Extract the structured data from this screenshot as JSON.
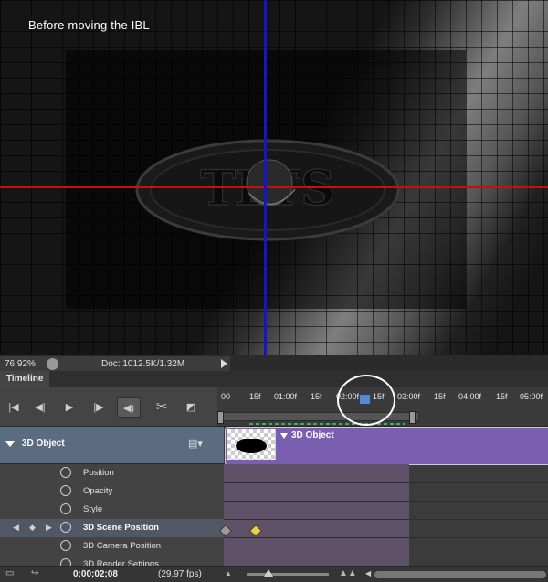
{
  "viewport": {
    "caption": "Before moving the IBL",
    "logo_text": "TLTS"
  },
  "status": {
    "zoom": "76.92%",
    "doc": "Doc: 1012.5K/1.32M"
  },
  "panel": {
    "tab": "Timeline"
  },
  "ruler": {
    "ticks": [
      "00",
      "15f",
      "01:00f",
      "15f",
      "02:00f",
      "15f",
      "03:00f",
      "15f",
      "04:00f",
      "15f",
      "05:00f"
    ]
  },
  "layer": {
    "name": "3D Object",
    "clip_title": "3D Object",
    "properties": [
      {
        "label": "Position"
      },
      {
        "label": "Opacity"
      },
      {
        "label": "Style"
      },
      {
        "label": "3D Scene Position"
      },
      {
        "label": "3D Camera Position"
      },
      {
        "label": "3D Render Settings"
      }
    ],
    "selected_property": "3D Scene Position"
  },
  "bottom": {
    "timecode": "0;00;02;08",
    "fps": "(29.97 fps)"
  },
  "colors": {
    "x_axis": "#c31010",
    "y_axis": "#1414c8",
    "clip": "#7a5fb0",
    "playhead": "#5d88c7",
    "keyframe_active": "#e6d24a",
    "keyframe_inactive": "#9a9a9a"
  },
  "icons": [
    "share-icon",
    "menu-arrow-icon",
    "go-to-first-frame-icon",
    "previous-frame-icon",
    "play-icon",
    "next-frame-icon",
    "audio-icon",
    "split-scissors-icon",
    "transition-icon",
    "film-strip-icon",
    "stopwatch-icon",
    "keyframe-diamond-icon",
    "render-icon",
    "zoom-out-mountain-icon",
    "zoom-in-mountain-icon"
  ]
}
